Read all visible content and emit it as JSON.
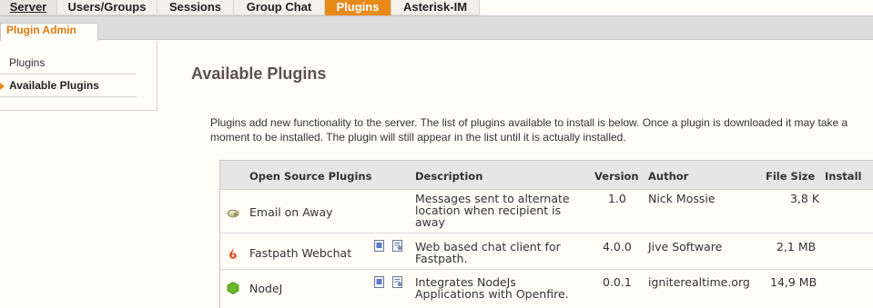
{
  "topnav": {
    "tabs": [
      {
        "label": "Server"
      },
      {
        "label": "Users/Groups"
      },
      {
        "label": "Sessions"
      },
      {
        "label": "Group Chat"
      },
      {
        "label": "Plugins"
      },
      {
        "label": "Asterisk-IM"
      }
    ],
    "active_tab": "Plugins"
  },
  "subnav": {
    "label": "Plugin Admin"
  },
  "sidebar": {
    "items": [
      {
        "label": "Plugins"
      },
      {
        "label": "Available Plugins"
      }
    ],
    "selected": "Available Plugins"
  },
  "page": {
    "title": "Available Plugins",
    "intro_line1": "Plugins add new functionality to the server. The list of plugins available to install is below. Once a plugin is downloaded it may take a",
    "intro_line2": "moment to be installed. The plugin will still appear in the list until it is actually installed."
  },
  "table": {
    "headers": {
      "name": "Open Source Plugins",
      "description": "Description",
      "version": "Version",
      "author": "Author",
      "file_size": "File Size",
      "install": "Install"
    },
    "rows": [
      {
        "name": "Email on Away",
        "icon": "email-away-icon",
        "description_lines": [
          "Messages sent to alternate",
          "location when recipient is",
          "away"
        ],
        "version": "1.0",
        "author": "Nick Mossie",
        "file_size": "3,8 K"
      },
      {
        "name": "Fastpath Webchat",
        "icon": "fastpath-icon",
        "description_lines": [
          "Web based chat client for",
          "Fastpath."
        ],
        "version": "4.0.0",
        "author": "Jive Software",
        "file_size": "2,1 MB"
      },
      {
        "name": "NodeJ",
        "icon": "nodej-icon",
        "description_lines": [
          "Integrates NodeJs",
          "Applications with Openfire."
        ],
        "version": "0.0.1",
        "author": "igniterealtime.org",
        "file_size": "14,9 MB"
      }
    ]
  },
  "colors": {
    "accent": "#e88a1a",
    "background": "#fffdf6",
    "header_bg": "#e6e6e6"
  }
}
